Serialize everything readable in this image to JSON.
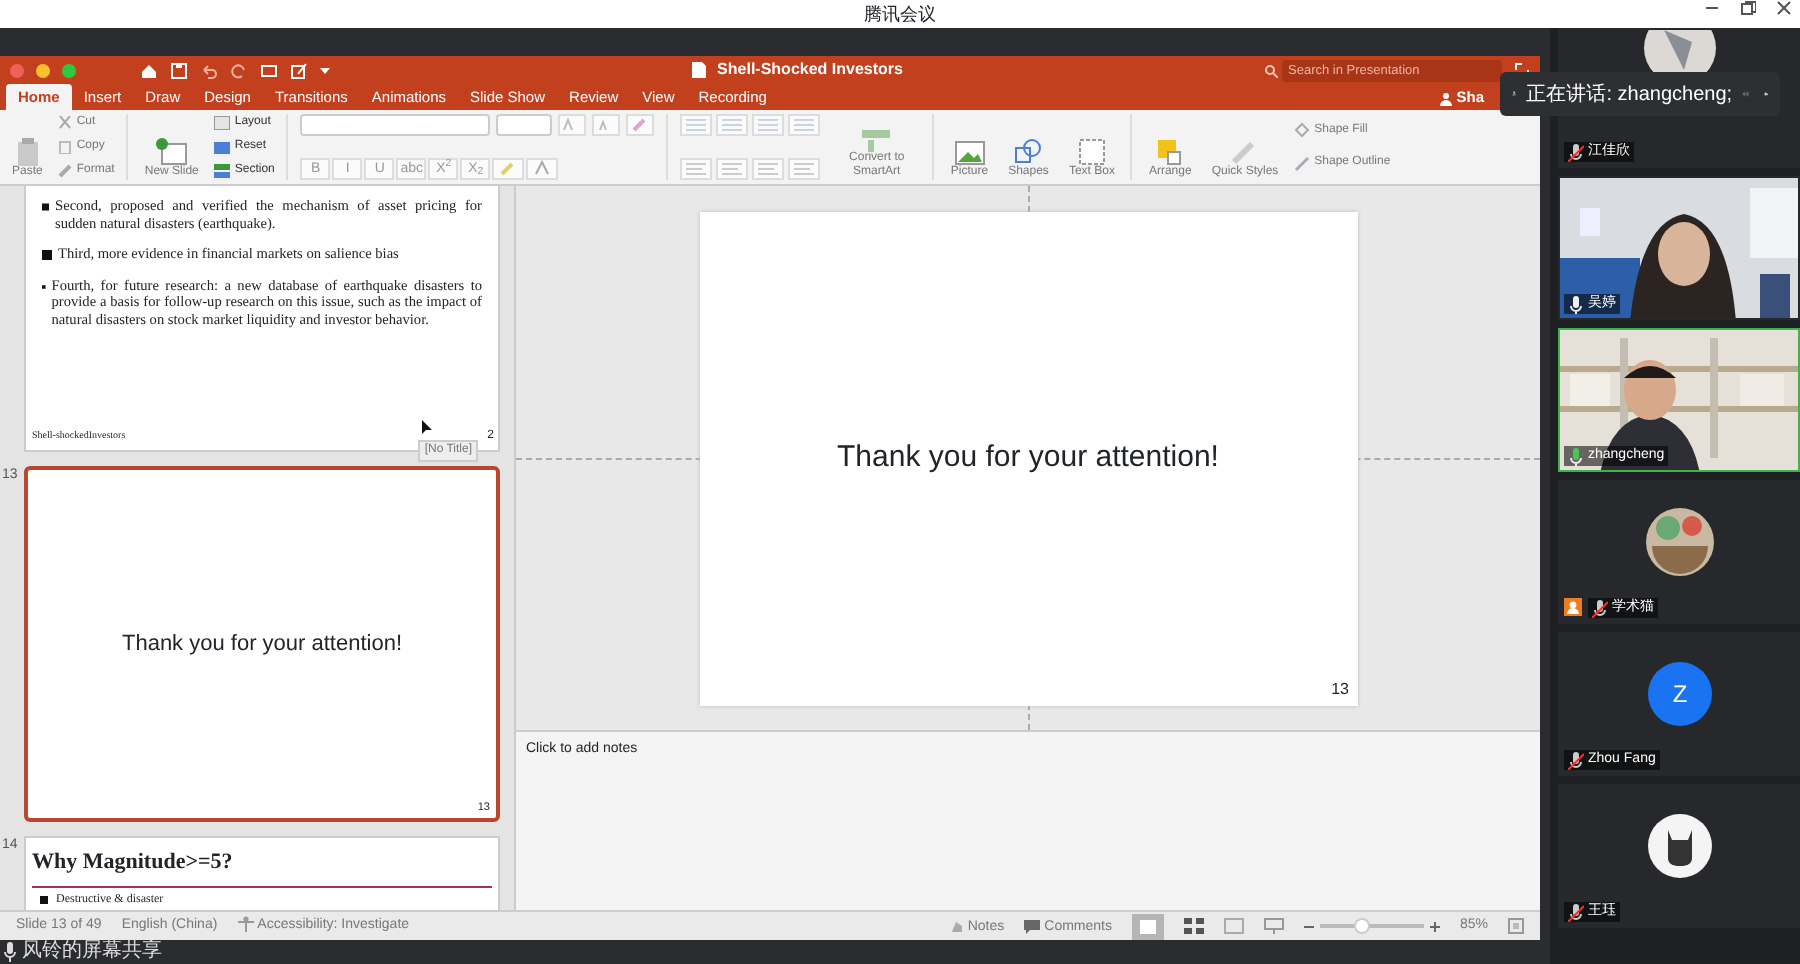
{
  "app_title": "腾讯会议",
  "ppt": {
    "title": "Shell-Shocked Investors",
    "search": {
      "placeholder": "Search in Presentation"
    },
    "share": "Sha",
    "tabs": [
      {
        "label": "Home",
        "selected": true
      },
      {
        "label": "Insert",
        "selected": false
      },
      {
        "label": "Draw",
        "selected": false
      },
      {
        "label": "Design",
        "selected": false
      },
      {
        "label": "Transitions",
        "selected": false
      },
      {
        "label": "Animations",
        "selected": false
      },
      {
        "label": "Slide Show",
        "selected": false
      },
      {
        "label": "Review",
        "selected": false
      },
      {
        "label": "View",
        "selected": false
      },
      {
        "label": "Recording",
        "selected": false
      }
    ],
    "ribbon": {
      "paste": "Paste",
      "cut": "Cut",
      "copy": "Copy",
      "format": "Format",
      "new_slide": "New Slide",
      "layout": "Layout",
      "reset": "Reset",
      "section": "Section",
      "format_buttons": [
        "B",
        "I",
        "U",
        "abc",
        "X$^{2}$",
        "X$_{2}$"
      ],
      "smartart": "Convert to SmartArt",
      "picture": "Picture",
      "shapes": "Shapes",
      "text_box": "Text Box",
      "arrange": "Arrange",
      "quick_styles": "Quick Styles",
      "shape_fill": "Shape Fill",
      "shape_outline": "Shape Outline"
    },
    "thumbnails": [
      {
        "kind": "bullets",
        "selected": false,
        "bullets": [
          "Second, proposed and verified the mechanism of asset pricing for sudden natural disasters (earthquake).",
          "Third, more evidence in financial markets on salience bias",
          "Fourth, for future research: a new database of earthquake disasters to provide a basis for follow-up research on this issue, such as the impact of natural disasters on stock market liquidity and investor behavior."
        ],
        "footer": "Shell-shockedInvestors",
        "page": "2",
        "tooltip": "[No Title]"
      },
      {
        "kind": "center",
        "selected": true,
        "number": "13",
        "text": "Thank you for your attention!",
        "page": "13"
      },
      {
        "kind": "heading",
        "selected": false,
        "number": "14",
        "heading": "Why Magnitude>=5?",
        "bullets": [
          "Destructive & disaster"
        ]
      }
    ],
    "slide": {
      "text": "Thank you for your attention!",
      "page": "13"
    },
    "notes": {
      "placeholder": "Click to add notes"
    },
    "status": {
      "slide": "Slide 13 of 49",
      "language": "English (China)",
      "accessibility": "Accessibility: Investigate",
      "notes": "Notes",
      "comments": "Comments",
      "zoom": {
        "level": 0.4
      },
      "zoom_reading": "85%"
    }
  },
  "speaker": {
    "text": "正在讲话: zhangcheng;"
  },
  "participants": [
    {
      "name": "江佳欣",
      "kind": "avatar_photo",
      "muted": true,
      "speaking": false,
      "host": false
    },
    {
      "name": "吴婷",
      "kind": "camera",
      "muted": false,
      "speaking": false,
      "host": false
    },
    {
      "name": "zhangcheng",
      "kind": "camera",
      "muted": false,
      "speaking": true,
      "host": false
    },
    {
      "name": "学术猫",
      "kind": "avatar_photo",
      "muted": true,
      "speaking": false,
      "host": true
    },
    {
      "name": "Zhou Fang",
      "kind": "letter",
      "letter": "Z",
      "muted": true,
      "speaking": false,
      "host": false
    },
    {
      "name": "王珏",
      "kind": "cat",
      "muted": true,
      "speaking": false,
      "host": false
    }
  ],
  "share_label": "风铃的屏幕共享"
}
